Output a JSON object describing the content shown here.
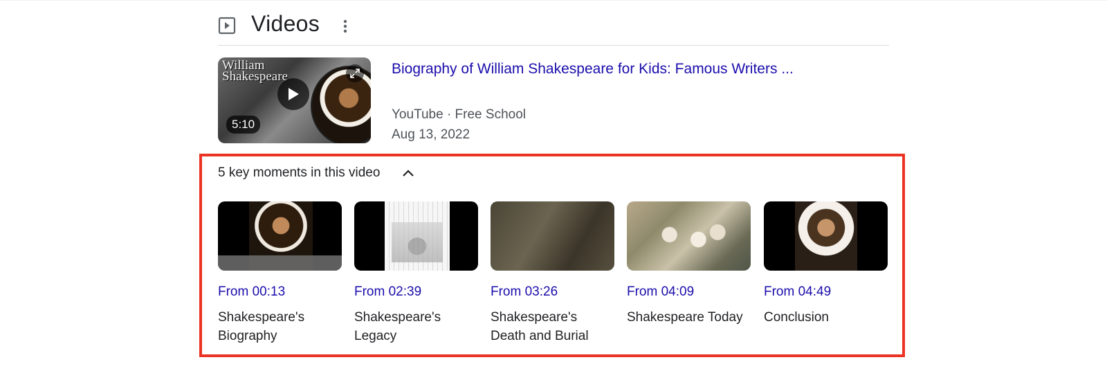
{
  "header": {
    "title": "Videos",
    "icons": {
      "section": "play-box-icon",
      "more": "more-vert-icon"
    }
  },
  "result": {
    "title": "Biography of William Shakespeare for Kids: Famous Writers ...",
    "source": "YouTube · Free School",
    "date": "Aug 13, 2022",
    "duration": "5:10",
    "thumbnail_text": "William Shakespeare",
    "icons": {
      "play": "play-icon",
      "expand": "expand-icon"
    }
  },
  "key_moments": {
    "header": "5 key moments in this video",
    "toggle_icon": "chevron-up-icon",
    "highlight_color": "#ea3323",
    "items": [
      {
        "time": "From 00:13",
        "label": "Shakespeare's Biography"
      },
      {
        "time": "From 02:39",
        "label": "Shakespeare's Legacy"
      },
      {
        "time": "From 03:26",
        "label": "Shakespeare's Death and Burial"
      },
      {
        "time": "From 04:09",
        "label": "Shakespeare Today"
      },
      {
        "time": "From 04:49",
        "label": "Conclusion"
      }
    ]
  },
  "colors": {
    "link": "#1a0dab",
    "text": "#202124",
    "meta": "#4d5156"
  }
}
